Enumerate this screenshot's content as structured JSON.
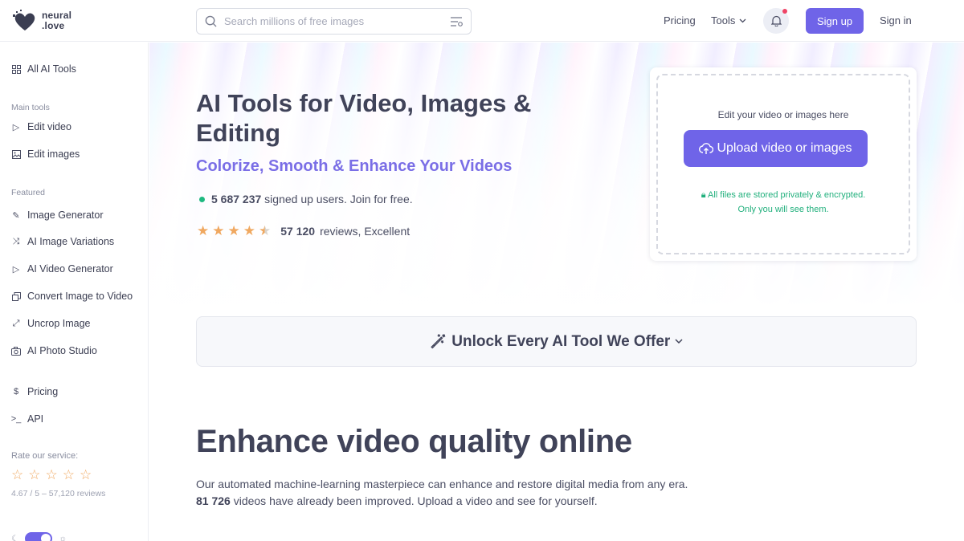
{
  "brand": {
    "line1": "neural",
    "line2": ".love"
  },
  "search": {
    "placeholder": "Search millions of free images"
  },
  "nav": {
    "pricing": "Pricing",
    "tools": "Tools",
    "signup": "Sign up",
    "signin": "Sign in"
  },
  "sidebar": {
    "all_tools": "All AI Tools",
    "main_heading": "Main tools",
    "main": [
      {
        "label": "Edit video",
        "icon": "play-icon"
      },
      {
        "label": "Edit images",
        "icon": "image-icon"
      }
    ],
    "featured_heading": "Featured",
    "featured": [
      {
        "label": "Image Generator",
        "icon": "brush-icon"
      },
      {
        "label": "AI Image Variations",
        "icon": "shuffle-icon"
      },
      {
        "label": "AI Video Generator",
        "icon": "play-icon"
      },
      {
        "label": "Convert Image to Video",
        "icon": "stack-icon"
      },
      {
        "label": "Uncrop Image",
        "icon": "expand-icon"
      },
      {
        "label": "AI Photo Studio",
        "icon": "camera-icon"
      }
    ],
    "other": [
      {
        "label": "Pricing",
        "icon": "dollar-icon"
      },
      {
        "label": "API",
        "icon": "terminal-icon"
      }
    ],
    "rate_label": "Rate our service:",
    "rate_info": "4.67 / 5 – 57,120 reviews"
  },
  "hero": {
    "title": "AI Tools for Video, Images & Editing",
    "subtitle": "Colorize, Smooth & Enhance Your Videos",
    "users_count": "5 687 237",
    "users_text": " signed up users. Join for free.",
    "rating_stars": 4.5,
    "reviews_count": "57 120",
    "reviews_text": " reviews, Excellent"
  },
  "upload": {
    "hint": "Edit your video or images here",
    "button": "Upload video or images",
    "secure_line1": "All files are stored privately & encrypted.",
    "secure_line2": "Only you will see them."
  },
  "unlock": {
    "label": "Unlock Every AI Tool We Offer"
  },
  "enhance": {
    "title": "Enhance video quality online",
    "line1": "Our automated machine-learning masterpiece can enhance and restore digital media from any era.",
    "count": "81 726",
    "line2": " videos have already been improved. Upload a video and see for yourself."
  },
  "colors": {
    "accent": "#6f64e8",
    "success": "#1eb980",
    "star": "#f0a860"
  }
}
